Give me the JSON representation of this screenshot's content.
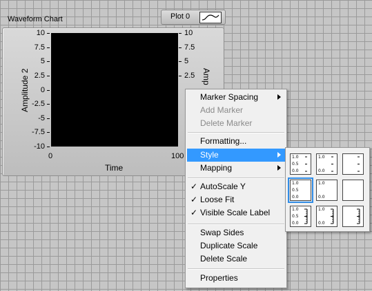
{
  "chart": {
    "title": "Waveform Chart",
    "y_axis_left": {
      "label": "Amplitude 2",
      "ticks": [
        "10",
        "7.5",
        "5",
        "2.5",
        "0",
        "-2.5",
        "-5",
        "-7.5",
        "-10"
      ]
    },
    "y_axis_right": {
      "label": "Amp",
      "ticks": [
        "10",
        "7.5",
        "5",
        "2.5"
      ]
    },
    "x_axis": {
      "label": "Time",
      "ticks": [
        "0",
        "100"
      ]
    },
    "plot_area_color": "#000000"
  },
  "plot_legend": {
    "label": "Plot 0",
    "swatch_icon": "sine-wave-icon"
  },
  "context_menu": {
    "items": [
      {
        "label": "Marker Spacing",
        "submenu": true,
        "disabled": false,
        "checked": false
      },
      {
        "label": "Add Marker",
        "submenu": false,
        "disabled": true,
        "checked": false
      },
      {
        "label": "Delete Marker",
        "submenu": false,
        "disabled": true,
        "checked": false
      },
      {
        "label": "Formatting...",
        "submenu": false,
        "disabled": false,
        "checked": false
      },
      {
        "label": "Style",
        "submenu": true,
        "disabled": false,
        "checked": false,
        "highlighted": true
      },
      {
        "label": "Mapping",
        "submenu": true,
        "disabled": false,
        "checked": false
      },
      {
        "label": "AutoScale Y",
        "submenu": false,
        "disabled": false,
        "checked": true
      },
      {
        "label": "Loose Fit",
        "submenu": false,
        "disabled": false,
        "checked": true
      },
      {
        "label": "Visible Scale Label",
        "submenu": false,
        "disabled": false,
        "checked": true
      },
      {
        "label": "Swap Sides",
        "submenu": false,
        "disabled": false,
        "checked": false
      },
      {
        "label": "Duplicate Scale",
        "submenu": false,
        "disabled": false,
        "checked": false
      },
      {
        "label": "Delete Scale",
        "submenu": false,
        "disabled": false,
        "checked": false
      },
      {
        "label": "Properties",
        "submenu": false,
        "disabled": false,
        "checked": false
      }
    ],
    "check_glyph": "✓",
    "highlight_color": "#3399ff"
  },
  "style_submenu": {
    "selected_index": 3,
    "options": [
      {
        "icon": "scale-style-major-minor-labels-icon",
        "labels": [
          "1.0",
          "0.5",
          "0.0"
        ]
      },
      {
        "icon": "scale-style-major-labels-icon",
        "labels": [
          "1.0",
          "",
          "0.0"
        ]
      },
      {
        "icon": "scale-style-ticks-only-icon",
        "labels": [
          "",
          "",
          ""
        ]
      },
      {
        "icon": "scale-style-labels-only-icon",
        "labels": [
          "1.0",
          "0.5",
          "0.0"
        ]
      },
      {
        "icon": "scale-style-sparse-labels-icon",
        "labels": [
          "1.0",
          "",
          "0.0"
        ]
      },
      {
        "icon": "scale-style-none-icon",
        "labels": [
          "",
          "",
          ""
        ]
      },
      {
        "icon": "scale-style-inner-ticks-labels-icon",
        "labels": [
          "1.0",
          "0.5",
          "0.0"
        ]
      },
      {
        "icon": "scale-style-inner-ticks-sparse-icon",
        "labels": [
          "1.0",
          "",
          "0.0"
        ]
      },
      {
        "icon": "scale-style-inner-ticks-only-icon",
        "labels": [
          "",
          "",
          ""
        ]
      }
    ]
  }
}
